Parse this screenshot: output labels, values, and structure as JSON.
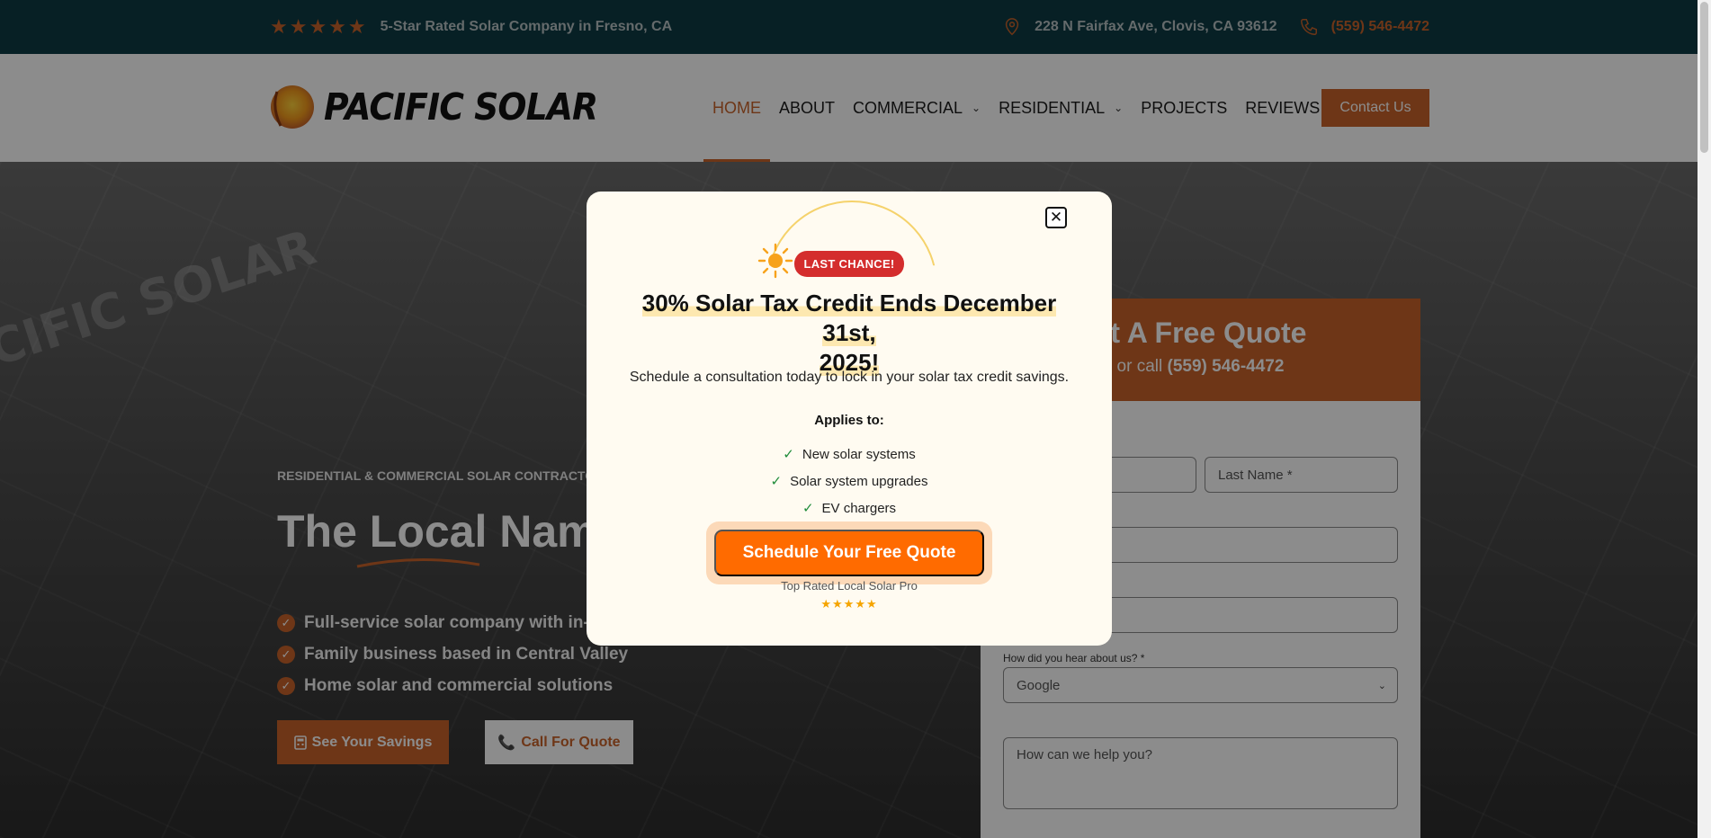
{
  "topbar": {
    "rating_stars": "★★★★★",
    "rating_text": "5-Star Rated Solar Company in Fresno, CA",
    "address": "228 N Fairfax Ave, Clovis, CA 93612",
    "phone": "(559) 546-4472"
  },
  "header": {
    "logo_text": "PACIFIC SOLAR",
    "nav": [
      {
        "label": "HOME",
        "active": true
      },
      {
        "label": "ABOUT"
      },
      {
        "label": "COMMERCIAL",
        "dropdown": true
      },
      {
        "label": "RESIDENTIAL",
        "dropdown": true
      },
      {
        "label": "PROJECTS"
      },
      {
        "label": "REVIEWS"
      }
    ],
    "contact_label": "Contact Us"
  },
  "hero": {
    "watermark": "CIFIC SOLAR",
    "eyebrow": "RESIDENTIAL & COMMERCIAL SOLAR CONTRACTO",
    "title": "The Local Name",
    "bullets": [
      "Full-service solar company with in-h",
      "Family business based in Central Valley",
      "Home solar and commercial solutions"
    ],
    "savings_button": "See Your Savings",
    "call_button": "Call For Quote"
  },
  "quote": {
    "title": "et A Free Quote",
    "sub_prefix": "or call ",
    "sub_phone": "(559) 546-4472",
    "last_name_placeholder": "Last Name *",
    "heard_label": "How did you hear about us? *",
    "heard_value": "Google",
    "message_placeholder": "How can we help you?"
  },
  "modal": {
    "badge": "LAST CHANCE!",
    "title_line1": "30% Solar Tax Credit Ends December 31st,",
    "title_line2": "2025!",
    "text": "Schedule a consultation today to lock in your solar tax credit savings.",
    "applies_label": "Applies to:",
    "applies_items": [
      "New solar systems",
      "Solar system upgrades",
      "EV chargers"
    ],
    "cta": "Schedule Your Free Quote",
    "cta_sub": "Top Rated Local Solar Pro",
    "cta_stars": "★★★★★",
    "close_symbol": "✕"
  },
  "colors": {
    "brand_orange": "#c8632a",
    "topbar_teal": "#0d3b44",
    "cta_orange": "#ff6b00",
    "badge_red": "#d42d2d"
  }
}
